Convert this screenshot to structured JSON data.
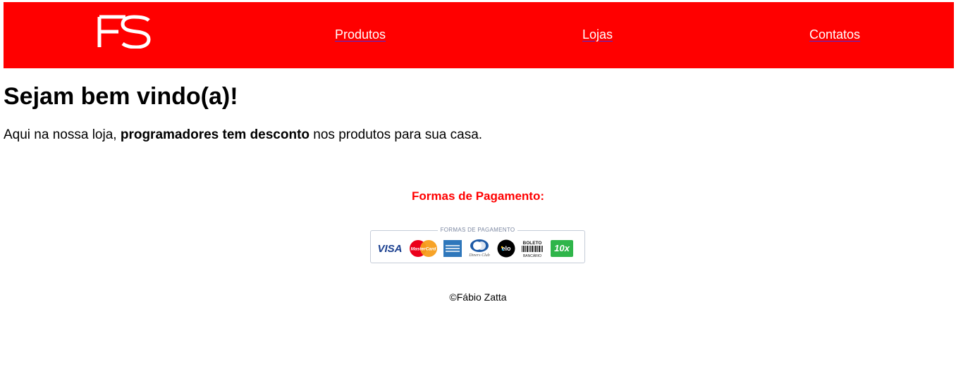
{
  "header": {
    "logo_text": "FS",
    "background_color": "#ff0000",
    "nav": {
      "produtos": "Produtos",
      "lojas": "Lojas",
      "contatos": "Contatos"
    }
  },
  "main": {
    "title": "Sejam bem vindo(a)!",
    "intro_start": "Aqui na nossa loja, ",
    "intro_bold": "programadores tem desconto",
    "intro_end": " nos produtos para sua casa."
  },
  "payment": {
    "title": "Formas de Pagamento:",
    "title_color": "#ff0000",
    "caption": "FORMAS DE PAGAMENTO",
    "methods": [
      "VISA",
      "MasterCard",
      "American Express",
      "Diners Club",
      "elo",
      "BOLETO BANCÁRIO",
      "10x"
    ]
  },
  "footer": {
    "copyright": "©Fábio Zatta"
  }
}
